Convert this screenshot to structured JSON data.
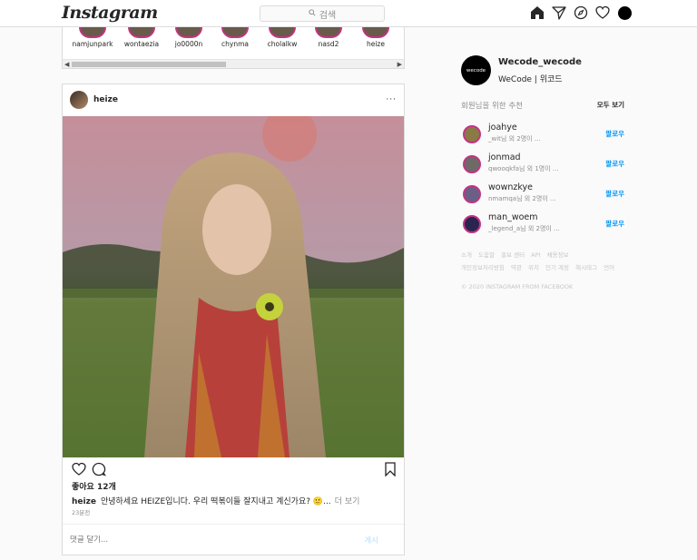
{
  "header": {
    "logo": "Instagram",
    "search_placeholder": "검색"
  },
  "stories": [
    {
      "name": "namjunpark"
    },
    {
      "name": "wontaezia"
    },
    {
      "name": "jo0000n"
    },
    {
      "name": "chynma"
    },
    {
      "name": "cholalkw"
    },
    {
      "name": "nasd2"
    },
    {
      "name": "heize"
    }
  ],
  "post": {
    "username": "heize",
    "more": "···",
    "likes": "좋아요 12개",
    "caption_user": "heize",
    "caption_text": "안녕하세요 HEIZE입니다. 우리 떡볶이들 잘지내고 계신가요? 🙂...",
    "caption_more": "더 보기",
    "time": "23분전",
    "comment_placeholder": "댓글 달기...",
    "post_button": "게시"
  },
  "profile": {
    "avatar_text": "wecode",
    "username": "Wecode_wecode",
    "subtitle": "WeCode | 위코드"
  },
  "suggestions": {
    "title": "회원님을 위한 추천",
    "see_all": "모두 보기",
    "items": [
      {
        "name": "joahye",
        "meta": "_wit님 외 2명이 ...",
        "action": "팔로우"
      },
      {
        "name": "jonmad",
        "meta": "qwooqkfa님 외 1명이 ...",
        "action": "팔로우"
      },
      {
        "name": "wownzkye",
        "meta": "nmamqa님 외 2명이 ...",
        "action": "팔로우"
      },
      {
        "name": "man_woem",
        "meta": "_legend_a님 외 2명이 ...",
        "action": "팔로우"
      }
    ]
  },
  "footer": {
    "row1": [
      "소개",
      "도움말",
      "홍보 센터",
      "API",
      "채용정보"
    ],
    "row2": [
      "개인정보처리방침",
      "약관",
      "위치",
      "인기 계정",
      "해시태그",
      "언어"
    ],
    "copyright": "© 2020 INSTAGRAM FROM FACEBOOK"
  },
  "colors": {
    "accent": "#0095f6",
    "story_ring": "#c13584",
    "border": "#dbdbdb"
  }
}
